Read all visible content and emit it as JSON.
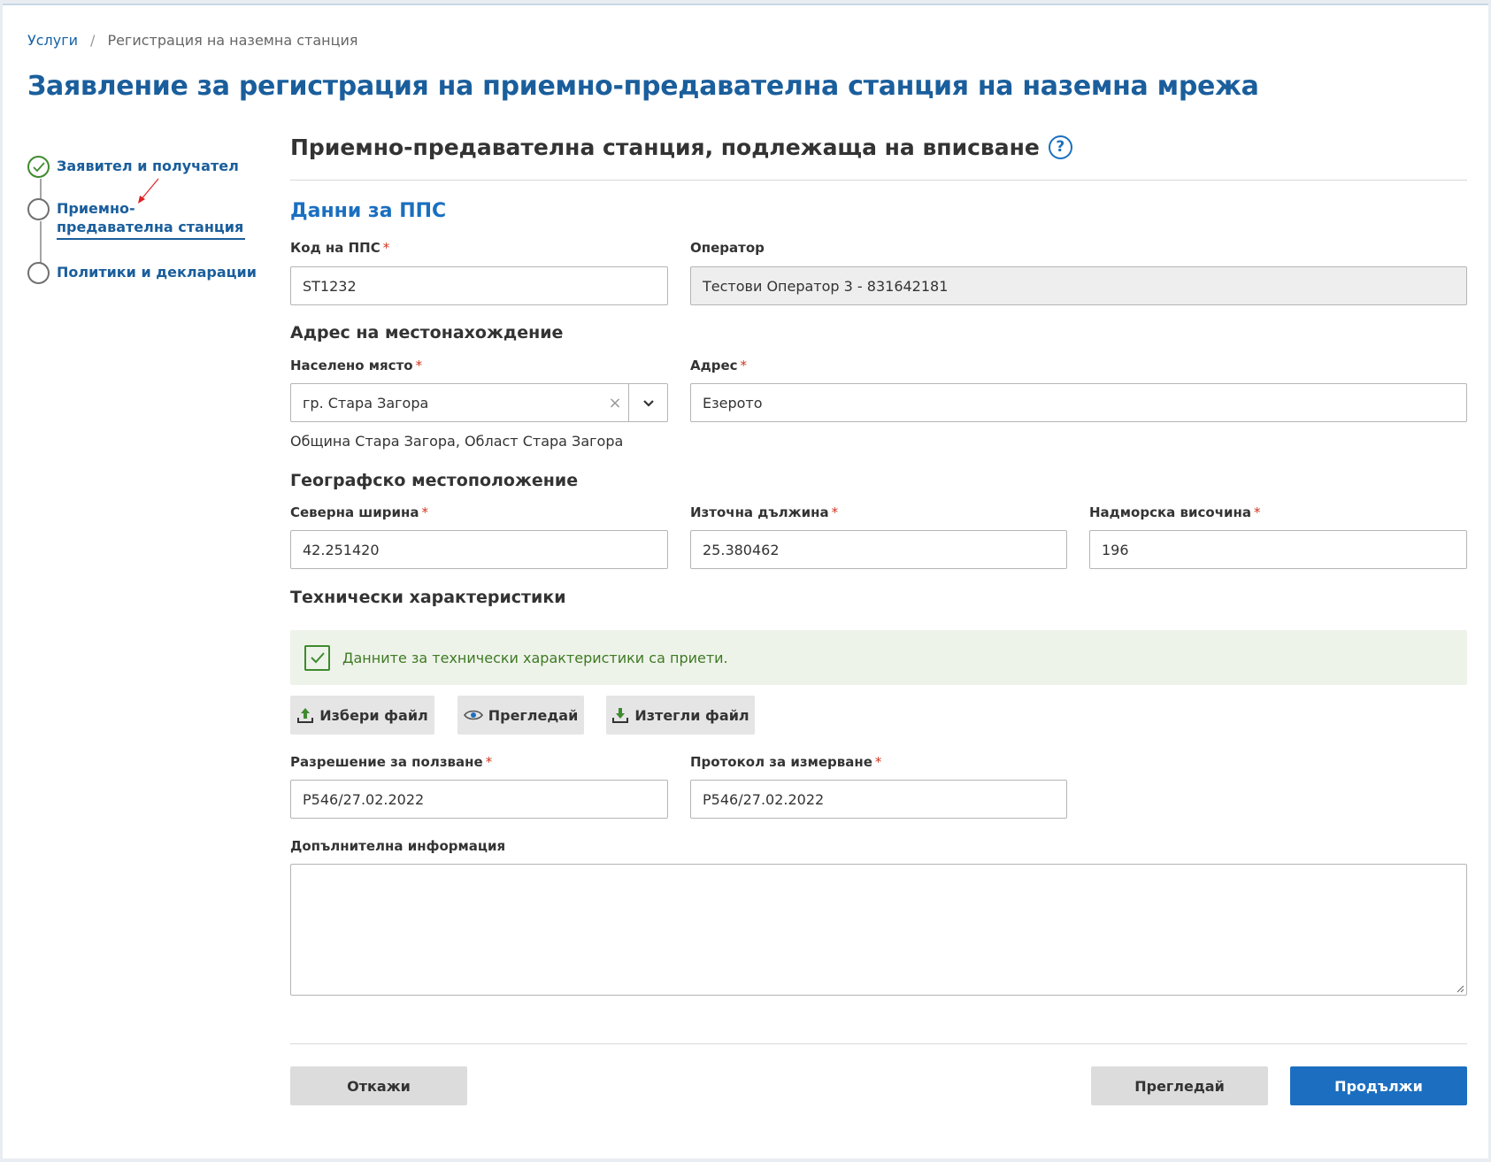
{
  "breadcrumb": {
    "home": "Услуги",
    "separator": "/",
    "current": "Регистрация на наземна станция"
  },
  "title": "Заявление за регистрация на приемно-предавателна станция на наземна мрежа",
  "stepper": {
    "steps": [
      {
        "label": "Заявител и получател",
        "status": "done"
      },
      {
        "label": "Приемно-предавателна станция",
        "status": "active"
      },
      {
        "label": "Политики и декларации",
        "status": "pending"
      }
    ]
  },
  "section": {
    "title": "Приемно-предавателна станция, подлежаща на вписване",
    "help_glyph": "?"
  },
  "pps": {
    "title": "Данни за ППС",
    "code_label": "Код на ППС",
    "code_value": "ST1232",
    "operator_label": "Оператор",
    "operator_value": "Тестови Оператор 3 - 831642181"
  },
  "address": {
    "title": "Адрес на местонахождение",
    "settlement_label": "Населено място",
    "settlement_value": "гр. Стара Загора",
    "settlement_clear": "×",
    "settlement_hint": "Община Стара Загора, Област Стара Загора",
    "address_label": "Адрес",
    "address_value": "Езерото"
  },
  "geo": {
    "title": "Географско местоположение",
    "lat_label": "Северна ширина",
    "lat_value": "42.251420",
    "lon_label": "Източна дължина",
    "lon_value": "25.380462",
    "alt_label": "Надморска височина",
    "alt_value": "196"
  },
  "tech": {
    "title": "Технически характеристики",
    "notice": "Данните за технически характеристики са приети.",
    "choose_file": "Избери файл",
    "preview": "Прегледай",
    "download_file": "Изтегли файл"
  },
  "permits": {
    "permit_label": "Разрешение за ползване",
    "permit_value": "Р546/27.02.2022",
    "protocol_label": "Протокол за измерване",
    "protocol_value": "Р546/27.02.2022"
  },
  "extra": {
    "label": "Допълнителна информация",
    "value": ""
  },
  "required_mark": "*",
  "footer": {
    "cancel": "Откажи",
    "preview": "Прегледай",
    "continue": "Продължи"
  },
  "colors": {
    "primary": "#1c6fc0",
    "heading": "#1a5e9c",
    "success": "#3e8a2e",
    "required": "#d0341f"
  }
}
